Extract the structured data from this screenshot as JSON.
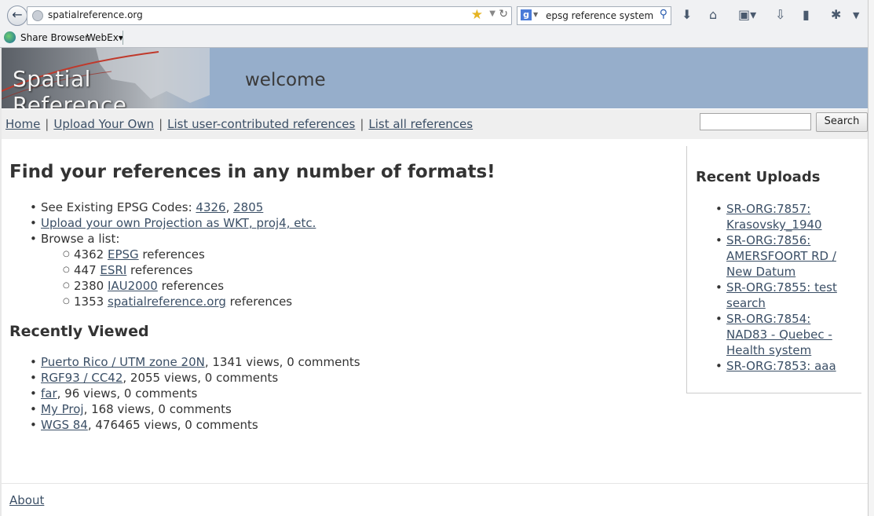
{
  "browser": {
    "url": "spatialreference.org",
    "search_query": "epsg reference system",
    "bookmarks": {
      "share_browser": "Share Browser",
      "webex": "WebEx▾"
    }
  },
  "header": {
    "site_title": "Spatial Reference",
    "welcome": "welcome"
  },
  "nav": {
    "home": "Home",
    "upload": "Upload Your Own",
    "list_user": "List user-contributed references",
    "list_all": "List all references",
    "search_button": "Search"
  },
  "main": {
    "title": "Find your references in any number of formats!",
    "existing_label": "See Existing EPSG Codes: ",
    "code1": "4326",
    "code2": "2805",
    "upload_link": "Upload your own Projection as WKT, proj4, etc.",
    "browse_label": "Browse a list:",
    "browse": [
      {
        "count": "4362",
        "name": "EPSG",
        "suffix": " references"
      },
      {
        "count": "447",
        "name": "ESRI",
        "suffix": " references"
      },
      {
        "count": "2380",
        "name": "IAU2000",
        "suffix": " references"
      },
      {
        "count": "1353",
        "name": "spatialreference.org",
        "suffix": " references"
      }
    ],
    "recent_title": "Recently Viewed",
    "recent": [
      {
        "name": "Puerto Rico / UTM zone 20N",
        "stats": ", 1341 views, 0 comments"
      },
      {
        "name": "RGF93 / CC42",
        "stats": ", 2055 views, 0 comments"
      },
      {
        "name": "far",
        "stats": ", 96 views, 0 comments"
      },
      {
        "name": "My Proj",
        "stats": ", 168 views, 0 comments"
      },
      {
        "name": "WGS 84",
        "stats": ", 476465 views, 0 comments"
      }
    ]
  },
  "sidebar": {
    "title": "Recent Uploads",
    "uploads": [
      "SR-ORG:7857: Krasovsky_1940",
      "SR-ORG:7856: AMERSFOORT RD / New Datum",
      "SR-ORG:7855: test search",
      "SR-ORG:7854: NAD83 - Quebec - Health system",
      "SR-ORG:7853: aaa"
    ]
  },
  "footer": {
    "about": "About"
  }
}
